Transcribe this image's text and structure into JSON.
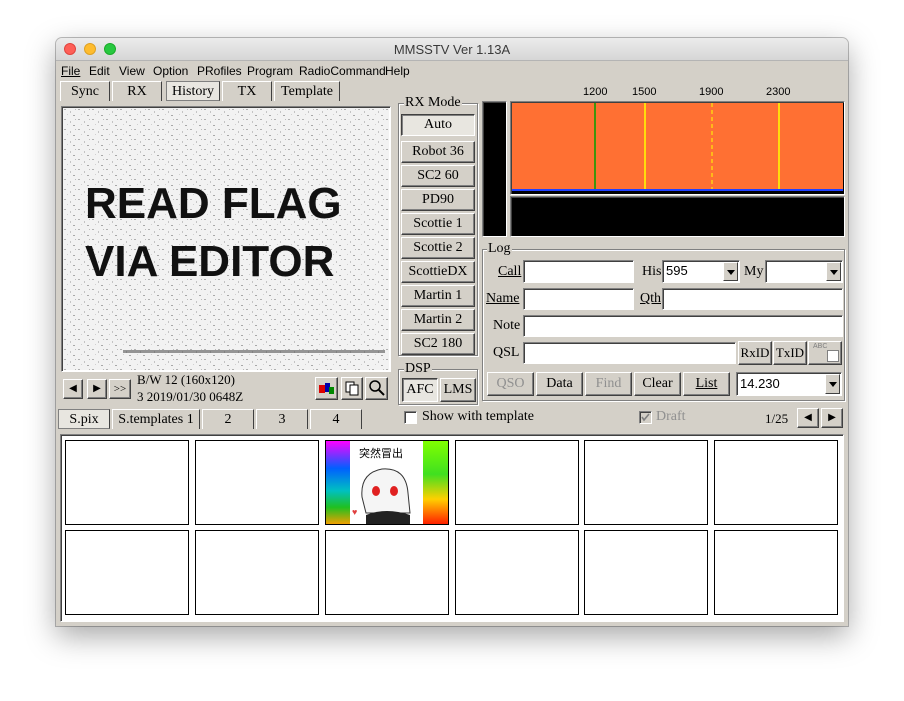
{
  "window": {
    "title": "MMSSTV Ver 1.13A"
  },
  "menu": [
    "File",
    "Edit",
    "View",
    "Option",
    "PRofiles",
    "Program",
    "RadioCommand",
    "Help"
  ],
  "tabs": [
    "Sync",
    "RX",
    "History",
    "TX",
    "Template"
  ],
  "selected_tab": "History",
  "image": {
    "line1": "READ FLAG",
    "line2": "VIA EDITOR"
  },
  "nav": {
    "prev": "◀",
    "next": "▶",
    "last": ">>"
  },
  "status": {
    "mode": "B/W 12 (160x120)",
    "info": "3 2019/01/30 0648Z"
  },
  "rx_mode": {
    "label": "RX Mode",
    "auto": "Auto",
    "modes": [
      "Robot 36",
      "SC2 60",
      "PD90",
      "Scottie 1",
      "Scottie 2",
      "ScottieDX",
      "Martin 1",
      "Martin 2",
      "SC2 180"
    ]
  },
  "dsp": {
    "label": "DSP",
    "afc": "AFC",
    "lms": "LMS"
  },
  "spectrum": {
    "ticks": [
      "1200",
      "1500",
      "1900",
      "2300"
    ],
    "bg_color": "#ff7033",
    "sync_line_color": "#00a000",
    "line_color": "#ffff00"
  },
  "log": {
    "label": "Log",
    "call_label": "Call",
    "his_label": "His",
    "his_value": "595",
    "my_label": "My",
    "my_value": "",
    "name_label": "Name",
    "qth_label": "Qth",
    "note_label": "Note",
    "qsl_label": "QSL",
    "rxid": "RxID",
    "txid": "TxID",
    "abc": "ABC"
  },
  "actions": {
    "qso": "QSO",
    "data": "Data",
    "find": "Find",
    "clear": "Clear",
    "list": "List",
    "freq": "14.230"
  },
  "stock_tabs": [
    "S.pix",
    "S.templates 1",
    "2",
    "3",
    "4"
  ],
  "show_with_template": "Show with template",
  "draft": "Draft",
  "page": "1/25",
  "thumbnail_text": "突然冒出"
}
